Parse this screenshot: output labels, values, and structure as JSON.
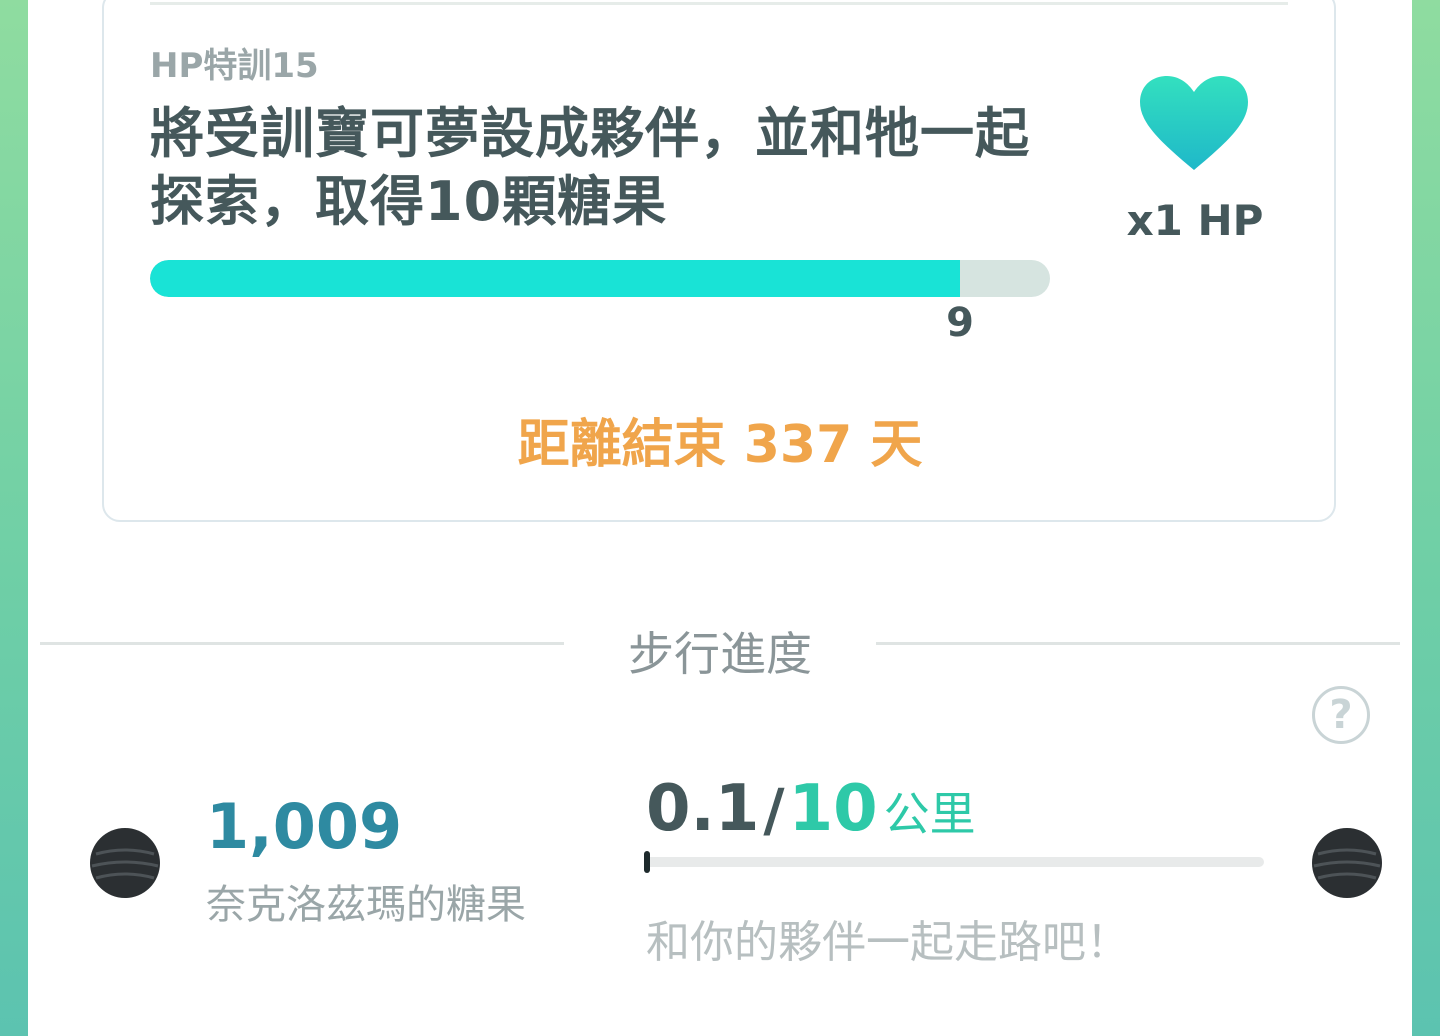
{
  "research": {
    "name": "HP特訓15",
    "task": "將受訓寶可夢設成夥伴，並和牠一起探索，取得10顆糖果",
    "progress_current": "9",
    "progress_fraction": 0.9,
    "reward_icon": "heart-icon",
    "reward_label": "x1 HP",
    "deadline": "距離結束 337 天",
    "colors": {
      "progress_fill": "#19e3d6",
      "heart": "#2dd6c2",
      "deadline": "#f0a54b"
    }
  },
  "buddy": {
    "section_title": "步行進度",
    "help_symbol": "?",
    "candy_count": "1,009",
    "candy_label": "奈克洛茲瑪的糖果",
    "km_current": "0.1",
    "km_separator": "/",
    "km_target": "10",
    "km_unit": "公里",
    "walk_fraction": 0.01,
    "walk_hint": "和你的夥伴一起走路吧！"
  }
}
